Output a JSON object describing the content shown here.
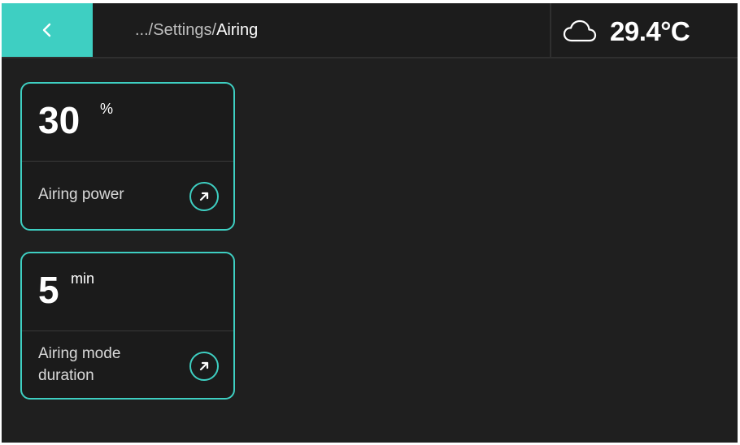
{
  "header": {
    "breadcrumb_prefix": ".../Settings/",
    "breadcrumb_current": "Airing",
    "back_icon": "chevron-left-icon",
    "accent_color": "#3ecfc2"
  },
  "weather": {
    "icon": "cloud-icon",
    "temperature": "29.4°C"
  },
  "cards": [
    {
      "value": "30",
      "unit": "%",
      "label": "Airing power",
      "action_icon": "arrow-up-right-icon"
    },
    {
      "value": "5",
      "unit": "min",
      "label_line1": "Airing mode",
      "label_line2": "duration",
      "action_icon": "arrow-up-right-icon"
    }
  ]
}
